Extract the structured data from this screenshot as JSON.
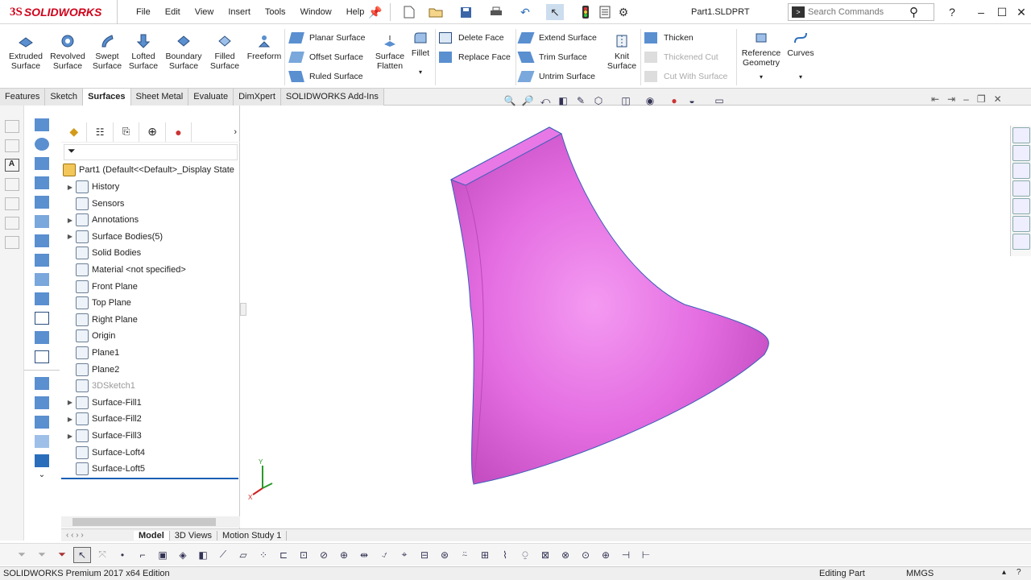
{
  "app": {
    "logo_ds": "3S",
    "logo_name": "SOLIDWORKS",
    "document_title": "Part1.SLDPRT"
  },
  "menu": [
    "File",
    "Edit",
    "View",
    "Insert",
    "Tools",
    "Window",
    "Help"
  ],
  "search": {
    "placeholder": "Search Commands"
  },
  "ribbon": {
    "big_buttons": [
      {
        "label1": "Extruded",
        "label2": "Surface",
        "icon": "extruded-surface-icon"
      },
      {
        "label1": "Revolved",
        "label2": "Surface",
        "icon": "revolved-surface-icon"
      },
      {
        "label1": "Swept",
        "label2": "Surface",
        "icon": "swept-surface-icon"
      },
      {
        "label1": "Lofted",
        "label2": "Surface",
        "icon": "lofted-surface-icon"
      },
      {
        "label1": "Boundary",
        "label2": "Surface",
        "icon": "boundary-surface-icon"
      },
      {
        "label1": "Filled",
        "label2": "Surface",
        "icon": "filled-surface-icon"
      },
      {
        "label1": "Freeform",
        "label2": "",
        "icon": "freeform-icon"
      }
    ],
    "group2": [
      "Planar Surface",
      "Offset Surface",
      "Ruled Surface"
    ],
    "surface_flatten": {
      "label1": "Surface",
      "label2": "Flatten"
    },
    "fillet": "Fillet",
    "group3": [
      "Delete Face",
      "Replace Face"
    ],
    "group4": [
      "Extend Surface",
      "Trim Surface",
      "Untrim Surface"
    ],
    "knit": {
      "label1": "Knit",
      "label2": "Surface"
    },
    "group5": [
      "Thicken",
      "Thickened Cut",
      "Cut With Surface"
    ],
    "reference_geometry": {
      "label1": "Reference",
      "label2": "Geometry"
    },
    "curves": "Curves"
  },
  "tabs": [
    "Features",
    "Sketch",
    "Surfaces",
    "Sheet Metal",
    "Evaluate",
    "DimXpert",
    "SOLIDWORKS Add-Ins"
  ],
  "active_tab": "Surfaces",
  "tree": {
    "root": "Part1  (Default<<Default>_Display State",
    "items": [
      {
        "label": "History",
        "expand": true,
        "dim": false
      },
      {
        "label": "Sensors",
        "expand": false,
        "dim": false
      },
      {
        "label": "Annotations",
        "expand": true,
        "dim": false
      },
      {
        "label": "Surface Bodies(5)",
        "expand": true,
        "dim": false
      },
      {
        "label": "Solid Bodies",
        "expand": false,
        "dim": false
      },
      {
        "label": "Material <not specified>",
        "expand": false,
        "dim": false
      },
      {
        "label": "Front Plane",
        "expand": false,
        "dim": false
      },
      {
        "label": "Top Plane",
        "expand": false,
        "dim": false
      },
      {
        "label": "Right Plane",
        "expand": false,
        "dim": false
      },
      {
        "label": "Origin",
        "expand": false,
        "dim": false
      },
      {
        "label": "Plane1",
        "expand": false,
        "dim": false
      },
      {
        "label": "Plane2",
        "expand": false,
        "dim": false
      },
      {
        "label": "3DSketch1",
        "expand": false,
        "dim": true
      },
      {
        "label": "Surface-Fill1",
        "expand": true,
        "dim": false
      },
      {
        "label": "Surface-Fill2",
        "expand": true,
        "dim": false
      },
      {
        "label": "Surface-Fill3",
        "expand": true,
        "dim": false
      },
      {
        "label": "Surface-Loft4",
        "expand": false,
        "dim": false
      },
      {
        "label": "Surface-Loft5",
        "expand": false,
        "dim": false
      }
    ]
  },
  "bottom_tabs": [
    "Model",
    "3D Views",
    "Motion Study 1"
  ],
  "status": {
    "edition": "SOLIDWORKS Premium 2017 x64 Edition",
    "mode": "Editing Part",
    "units": "MMGS"
  },
  "colors": {
    "surface": "#e36be0",
    "accent": "#1a5fb4"
  }
}
